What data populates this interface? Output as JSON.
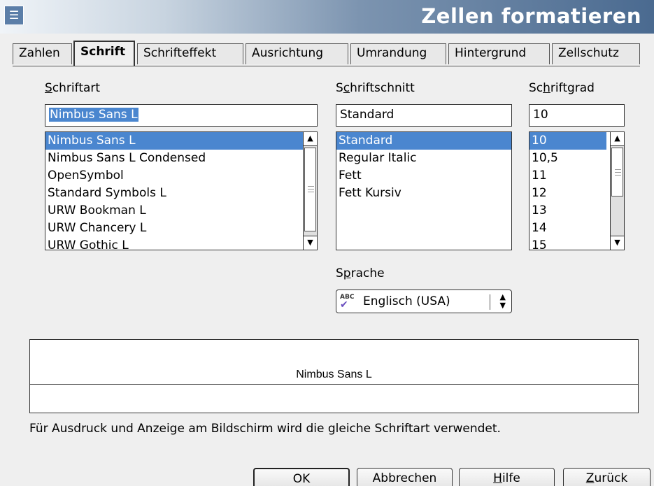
{
  "window": {
    "title": "Zellen formatieren"
  },
  "tabs": [
    {
      "label": "Zahlen"
    },
    {
      "label": "Schrift"
    },
    {
      "label": "Schrifteffekt"
    },
    {
      "label": "Ausrichtung"
    },
    {
      "label": "Umrandung"
    },
    {
      "label": "Hintergrund"
    },
    {
      "label": "Zellschutz"
    }
  ],
  "active_tab": "Schrift",
  "font": {
    "label_accel": "S",
    "label_rest": "chriftart",
    "value": "Nimbus Sans L",
    "items": [
      {
        "label": "Nimbus Sans L",
        "selected": true
      },
      {
        "label": "Nimbus Sans L Condensed"
      },
      {
        "label": "OpenSymbol"
      },
      {
        "label": "Standard Symbols L"
      },
      {
        "label": "URW Bookman L"
      },
      {
        "label": "URW Chancery L"
      },
      {
        "label": "URW Gothic L"
      }
    ]
  },
  "style": {
    "label_pre": "S",
    "label_accel": "c",
    "label_rest": "hriftschnitt",
    "value": "Standard",
    "items": [
      {
        "label": "Standard",
        "selected": true
      },
      {
        "label": "Regular Italic"
      },
      {
        "label": "Fett"
      },
      {
        "label": "Fett Kursiv"
      }
    ]
  },
  "size": {
    "label_pre": "Sc",
    "label_accel": "h",
    "label_rest": "riftgrad",
    "value": "10",
    "items": [
      {
        "label": "10",
        "selected": true
      },
      {
        "label": "10,5"
      },
      {
        "label": "11"
      },
      {
        "label": "12"
      },
      {
        "label": "13"
      },
      {
        "label": "14"
      },
      {
        "label": "15"
      }
    ]
  },
  "language": {
    "label_pre": "S",
    "label_accel": "p",
    "label_rest": "rache",
    "icon_text": "ABC",
    "value": "Englisch (USA)"
  },
  "preview": {
    "sample": "Nimbus Sans L"
  },
  "info_text": "Für Ausdruck und Anzeige am Bildschirm wird die gleiche Schriftart verwendet.",
  "buttons": {
    "ok": "OK",
    "cancel": "Abbrechen",
    "help_accel": "H",
    "help_rest": "ilfe",
    "reset_accel": "Z",
    "reset_rest": "urück"
  },
  "colors": {
    "selection": "#4a86cf",
    "dialog_bg": "#efefef"
  }
}
